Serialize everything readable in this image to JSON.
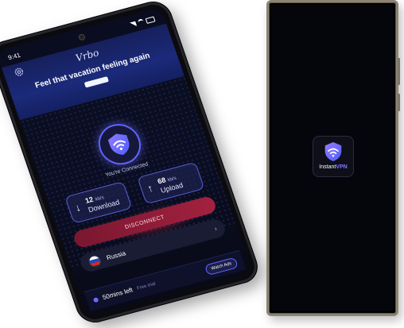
{
  "status_bar": {
    "time": "9:41"
  },
  "ad": {
    "logo": "Vrbo",
    "tagline": "",
    "headline": "Feel that vacation feeling again"
  },
  "connection": {
    "status": "You're Connected"
  },
  "stats": {
    "download": {
      "value": "12",
      "unit": "kb/s",
      "label": "Download",
      "arrow": "↓"
    },
    "upload": {
      "value": "68",
      "unit": "kb/s",
      "label": "Upload",
      "arrow": "↑"
    }
  },
  "disconnect_label": "DISCONNECT",
  "location": {
    "name": "Russia",
    "chevron": "›",
    "flag_colors": [
      "#ffffff",
      "#1f46c8",
      "#d52b1e"
    ]
  },
  "timer": {
    "time_left": "50mins left",
    "sub": "Free trial",
    "watch_ads_label": "Watch Ads"
  },
  "right_phone": {
    "app_name_prefix": "Instant",
    "app_name_suffix": "VPN"
  },
  "colors": {
    "accent": "#6366ff",
    "disconnect": "#a3213f"
  }
}
